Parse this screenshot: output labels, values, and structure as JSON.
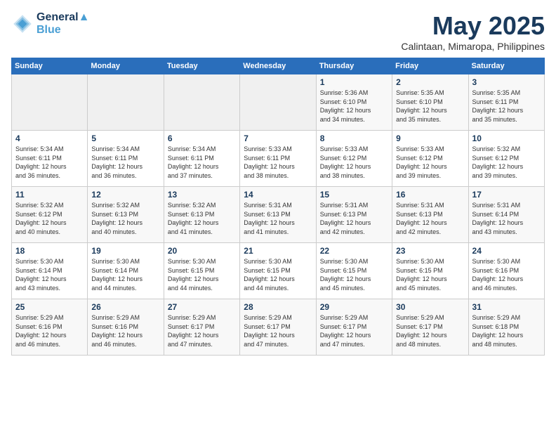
{
  "header": {
    "logo_line1": "General",
    "logo_line2": "Blue",
    "month_title": "May 2025",
    "location": "Calintaan, Mimaropa, Philippines"
  },
  "days_of_week": [
    "Sunday",
    "Monday",
    "Tuesday",
    "Wednesday",
    "Thursday",
    "Friday",
    "Saturday"
  ],
  "weeks": [
    [
      {
        "day": "",
        "info": ""
      },
      {
        "day": "",
        "info": ""
      },
      {
        "day": "",
        "info": ""
      },
      {
        "day": "",
        "info": ""
      },
      {
        "day": "1",
        "info": "Sunrise: 5:36 AM\nSunset: 6:10 PM\nDaylight: 12 hours\nand 34 minutes."
      },
      {
        "day": "2",
        "info": "Sunrise: 5:35 AM\nSunset: 6:10 PM\nDaylight: 12 hours\nand 35 minutes."
      },
      {
        "day": "3",
        "info": "Sunrise: 5:35 AM\nSunset: 6:11 PM\nDaylight: 12 hours\nand 35 minutes."
      }
    ],
    [
      {
        "day": "4",
        "info": "Sunrise: 5:34 AM\nSunset: 6:11 PM\nDaylight: 12 hours\nand 36 minutes."
      },
      {
        "day": "5",
        "info": "Sunrise: 5:34 AM\nSunset: 6:11 PM\nDaylight: 12 hours\nand 36 minutes."
      },
      {
        "day": "6",
        "info": "Sunrise: 5:34 AM\nSunset: 6:11 PM\nDaylight: 12 hours\nand 37 minutes."
      },
      {
        "day": "7",
        "info": "Sunrise: 5:33 AM\nSunset: 6:11 PM\nDaylight: 12 hours\nand 38 minutes."
      },
      {
        "day": "8",
        "info": "Sunrise: 5:33 AM\nSunset: 6:12 PM\nDaylight: 12 hours\nand 38 minutes."
      },
      {
        "day": "9",
        "info": "Sunrise: 5:33 AM\nSunset: 6:12 PM\nDaylight: 12 hours\nand 39 minutes."
      },
      {
        "day": "10",
        "info": "Sunrise: 5:32 AM\nSunset: 6:12 PM\nDaylight: 12 hours\nand 39 minutes."
      }
    ],
    [
      {
        "day": "11",
        "info": "Sunrise: 5:32 AM\nSunset: 6:12 PM\nDaylight: 12 hours\nand 40 minutes."
      },
      {
        "day": "12",
        "info": "Sunrise: 5:32 AM\nSunset: 6:13 PM\nDaylight: 12 hours\nand 40 minutes."
      },
      {
        "day": "13",
        "info": "Sunrise: 5:32 AM\nSunset: 6:13 PM\nDaylight: 12 hours\nand 41 minutes."
      },
      {
        "day": "14",
        "info": "Sunrise: 5:31 AM\nSunset: 6:13 PM\nDaylight: 12 hours\nand 41 minutes."
      },
      {
        "day": "15",
        "info": "Sunrise: 5:31 AM\nSunset: 6:13 PM\nDaylight: 12 hours\nand 42 minutes."
      },
      {
        "day": "16",
        "info": "Sunrise: 5:31 AM\nSunset: 6:13 PM\nDaylight: 12 hours\nand 42 minutes."
      },
      {
        "day": "17",
        "info": "Sunrise: 5:31 AM\nSunset: 6:14 PM\nDaylight: 12 hours\nand 43 minutes."
      }
    ],
    [
      {
        "day": "18",
        "info": "Sunrise: 5:30 AM\nSunset: 6:14 PM\nDaylight: 12 hours\nand 43 minutes."
      },
      {
        "day": "19",
        "info": "Sunrise: 5:30 AM\nSunset: 6:14 PM\nDaylight: 12 hours\nand 44 minutes."
      },
      {
        "day": "20",
        "info": "Sunrise: 5:30 AM\nSunset: 6:15 PM\nDaylight: 12 hours\nand 44 minutes."
      },
      {
        "day": "21",
        "info": "Sunrise: 5:30 AM\nSunset: 6:15 PM\nDaylight: 12 hours\nand 44 minutes."
      },
      {
        "day": "22",
        "info": "Sunrise: 5:30 AM\nSunset: 6:15 PM\nDaylight: 12 hours\nand 45 minutes."
      },
      {
        "day": "23",
        "info": "Sunrise: 5:30 AM\nSunset: 6:15 PM\nDaylight: 12 hours\nand 45 minutes."
      },
      {
        "day": "24",
        "info": "Sunrise: 5:30 AM\nSunset: 6:16 PM\nDaylight: 12 hours\nand 46 minutes."
      }
    ],
    [
      {
        "day": "25",
        "info": "Sunrise: 5:29 AM\nSunset: 6:16 PM\nDaylight: 12 hours\nand 46 minutes."
      },
      {
        "day": "26",
        "info": "Sunrise: 5:29 AM\nSunset: 6:16 PM\nDaylight: 12 hours\nand 46 minutes."
      },
      {
        "day": "27",
        "info": "Sunrise: 5:29 AM\nSunset: 6:17 PM\nDaylight: 12 hours\nand 47 minutes."
      },
      {
        "day": "28",
        "info": "Sunrise: 5:29 AM\nSunset: 6:17 PM\nDaylight: 12 hours\nand 47 minutes."
      },
      {
        "day": "29",
        "info": "Sunrise: 5:29 AM\nSunset: 6:17 PM\nDaylight: 12 hours\nand 47 minutes."
      },
      {
        "day": "30",
        "info": "Sunrise: 5:29 AM\nSunset: 6:17 PM\nDaylight: 12 hours\nand 48 minutes."
      },
      {
        "day": "31",
        "info": "Sunrise: 5:29 AM\nSunset: 6:18 PM\nDaylight: 12 hours\nand 48 minutes."
      }
    ]
  ]
}
